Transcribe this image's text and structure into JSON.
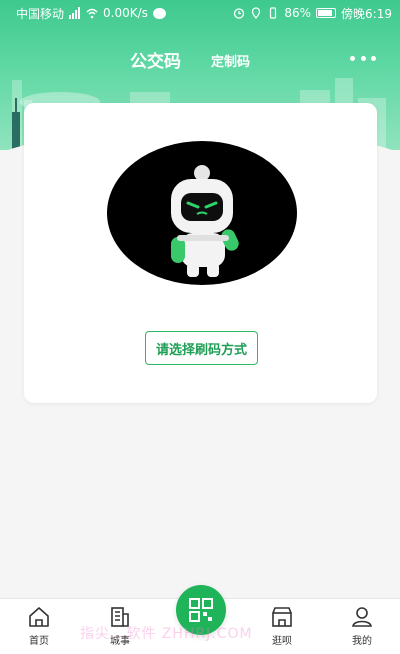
{
  "status_bar": {
    "carrier": "中国移动",
    "network_speed": "0.00K/s",
    "battery": "86%",
    "time": "傍晚6:19"
  },
  "nav": {
    "title": "公交码",
    "tab": "定制码"
  },
  "card": {
    "select_button": "请选择刷码方式"
  },
  "tabbar": {
    "items": [
      {
        "label": "首页",
        "icon": "home-icon"
      },
      {
        "label": "城事",
        "icon": "city-icon"
      },
      {
        "label": "",
        "icon": "qr-code-icon"
      },
      {
        "label": "逛呗",
        "icon": "shop-icon"
      },
      {
        "label": "我的",
        "icon": "profile-icon"
      }
    ]
  },
  "watermark": "指尖...软件 ZHHRJ.COM",
  "colors": {
    "brand_green": "#1fb45a",
    "header_green": "#3ec98e"
  }
}
